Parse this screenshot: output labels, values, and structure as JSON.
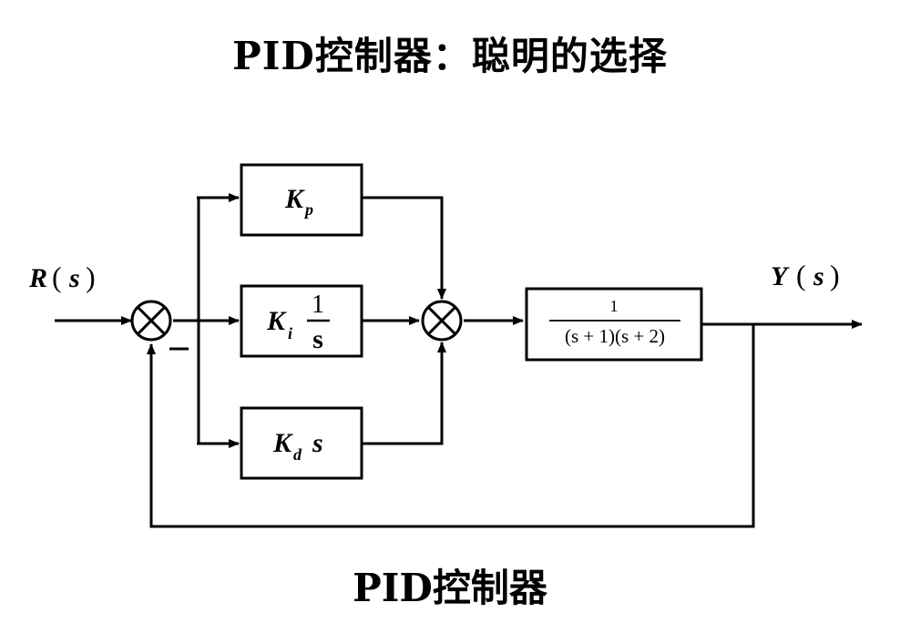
{
  "title": "PID控制器：聪明的选择",
  "caption": "PID控制器",
  "signals": {
    "input": {
      "name": "R",
      "arg": "s"
    },
    "output": {
      "name": "Y",
      "arg": "s"
    },
    "feedback_sign": "−"
  },
  "blocks": {
    "proportional": {
      "gain": "K",
      "sub": "p"
    },
    "integral": {
      "gain": "K",
      "sub": "i",
      "num": "1",
      "den": "s"
    },
    "derivative": {
      "gain": "K",
      "sub": "d",
      "var": "s"
    },
    "plant": {
      "num": "1",
      "den": "(s + 1)(s + 2)"
    }
  },
  "icons": {
    "summing_junction": "circle-cross-icon",
    "arrow": "arrowhead-icon"
  }
}
